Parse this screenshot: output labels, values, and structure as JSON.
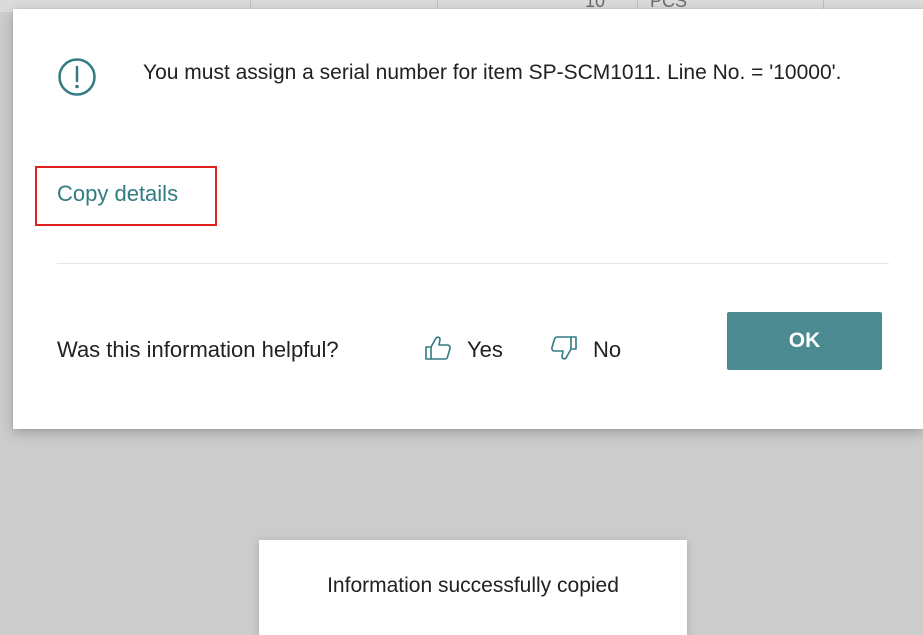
{
  "background": {
    "partial_text": [
      "10",
      "PCS"
    ]
  },
  "dialog": {
    "icon": "exclamation-circle-icon",
    "message": "You must assign a serial number for item SP-SCM1011. Line No. = '10000'.",
    "copy_details_label": "Copy details",
    "feedback": {
      "question": "Was this information helpful?",
      "yes_label": "Yes",
      "yes_icon": "thumbs-up-icon",
      "no_label": "No",
      "no_icon": "thumbs-down-icon"
    },
    "ok_label": "OK"
  },
  "toast": {
    "message": "Information successfully copied"
  },
  "colors": {
    "accent": "#317b82",
    "button": "#4a8a90",
    "highlight_box": "#e02020"
  }
}
